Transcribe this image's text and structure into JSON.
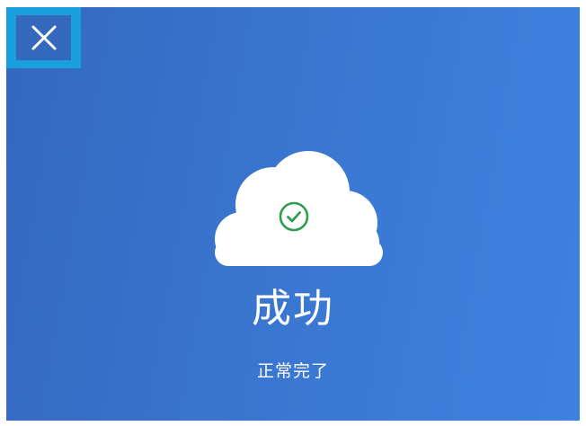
{
  "dialog": {
    "close_icon": "close-icon",
    "cloud_icon": "cloud-icon",
    "status_icon": "check-circle-icon",
    "title": "成功",
    "message": "正常完了"
  },
  "colors": {
    "background_start": "#3468bf",
    "background_end": "#3d82e0",
    "close_highlight": "#1aa0dc",
    "close_inner": "#3569bd",
    "cloud": "#ffffff",
    "check": "#2e9e4a",
    "text": "#ffffff"
  }
}
